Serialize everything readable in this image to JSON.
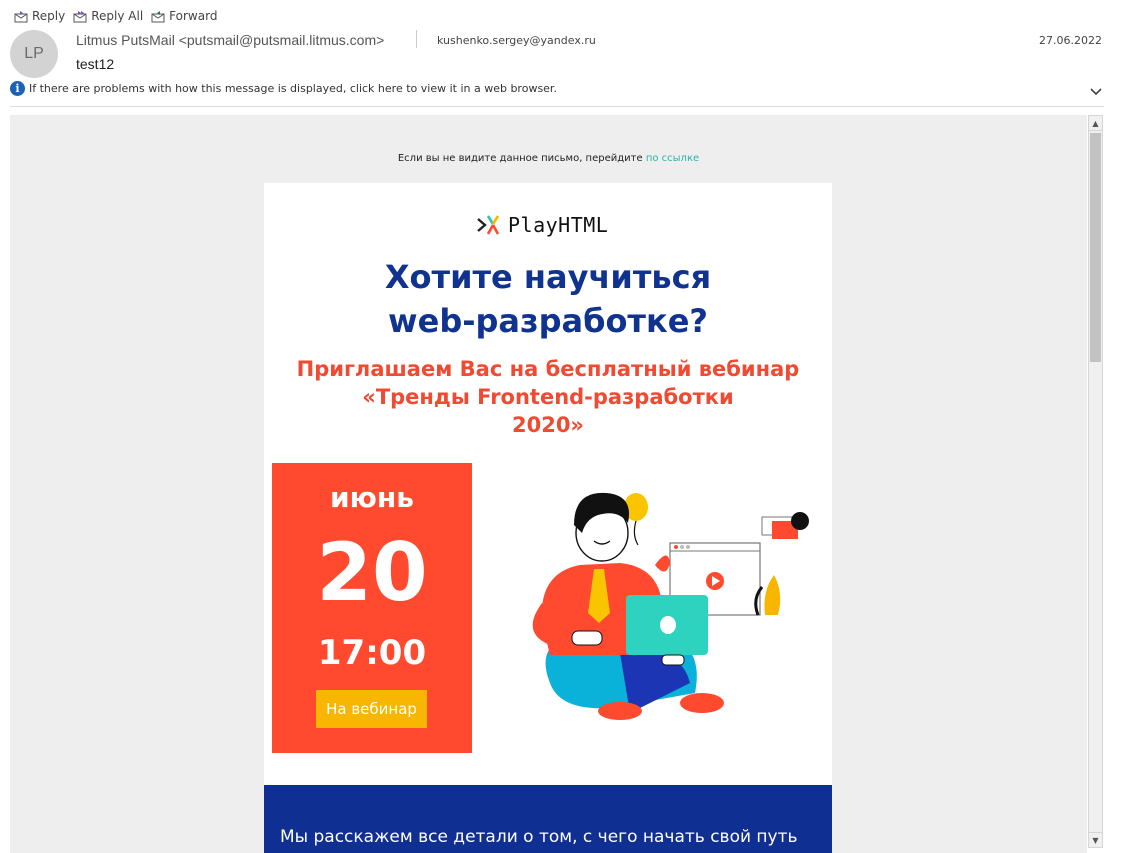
{
  "toolbar": {
    "reply": "Reply",
    "reply_all": "Reply All",
    "forward": "Forward"
  },
  "header": {
    "avatar_initials": "LP",
    "sender": "Litmus PutsMail <putsmail@putsmail.litmus.com>",
    "to": "kushenko.sergey@yandex.ru",
    "date": "27.06.2022",
    "subject": "test12"
  },
  "infobar": {
    "text": "If there are problems with how this message is displayed, click here to view it in a web browser."
  },
  "email": {
    "preheader_text": "Если вы не видите данное письмо, перейдите",
    "preheader_link": "по ссылке",
    "logo_text": "PlayHTML",
    "headline_line1": "Хотите научиться",
    "headline_line2": "web-разработке?",
    "subheadline_line1": "Приглашаем Вас на бесплатный вебинар",
    "subheadline_line2": "«Тренды Frontend-разработки",
    "subheadline_line3": "2020»",
    "month": "июнь",
    "day": "20",
    "time": "17:00",
    "cta": "На вебинар",
    "body_text": "Мы расскажем все детали о том, с чего начать свой путь"
  },
  "colors": {
    "headline": "#10338f",
    "accent_red": "#ff4a2f",
    "cta_yellow": "#f9b600",
    "link_teal": "#2ab3a8",
    "footer_blue": "#0f2f93"
  },
  "icons": [
    "reply-icon",
    "reply-all-icon",
    "forward-icon",
    "info-icon",
    "chevron-down-icon",
    "scroll-up-icon",
    "scroll-down-icon",
    "playhtml-logo-icon"
  ]
}
